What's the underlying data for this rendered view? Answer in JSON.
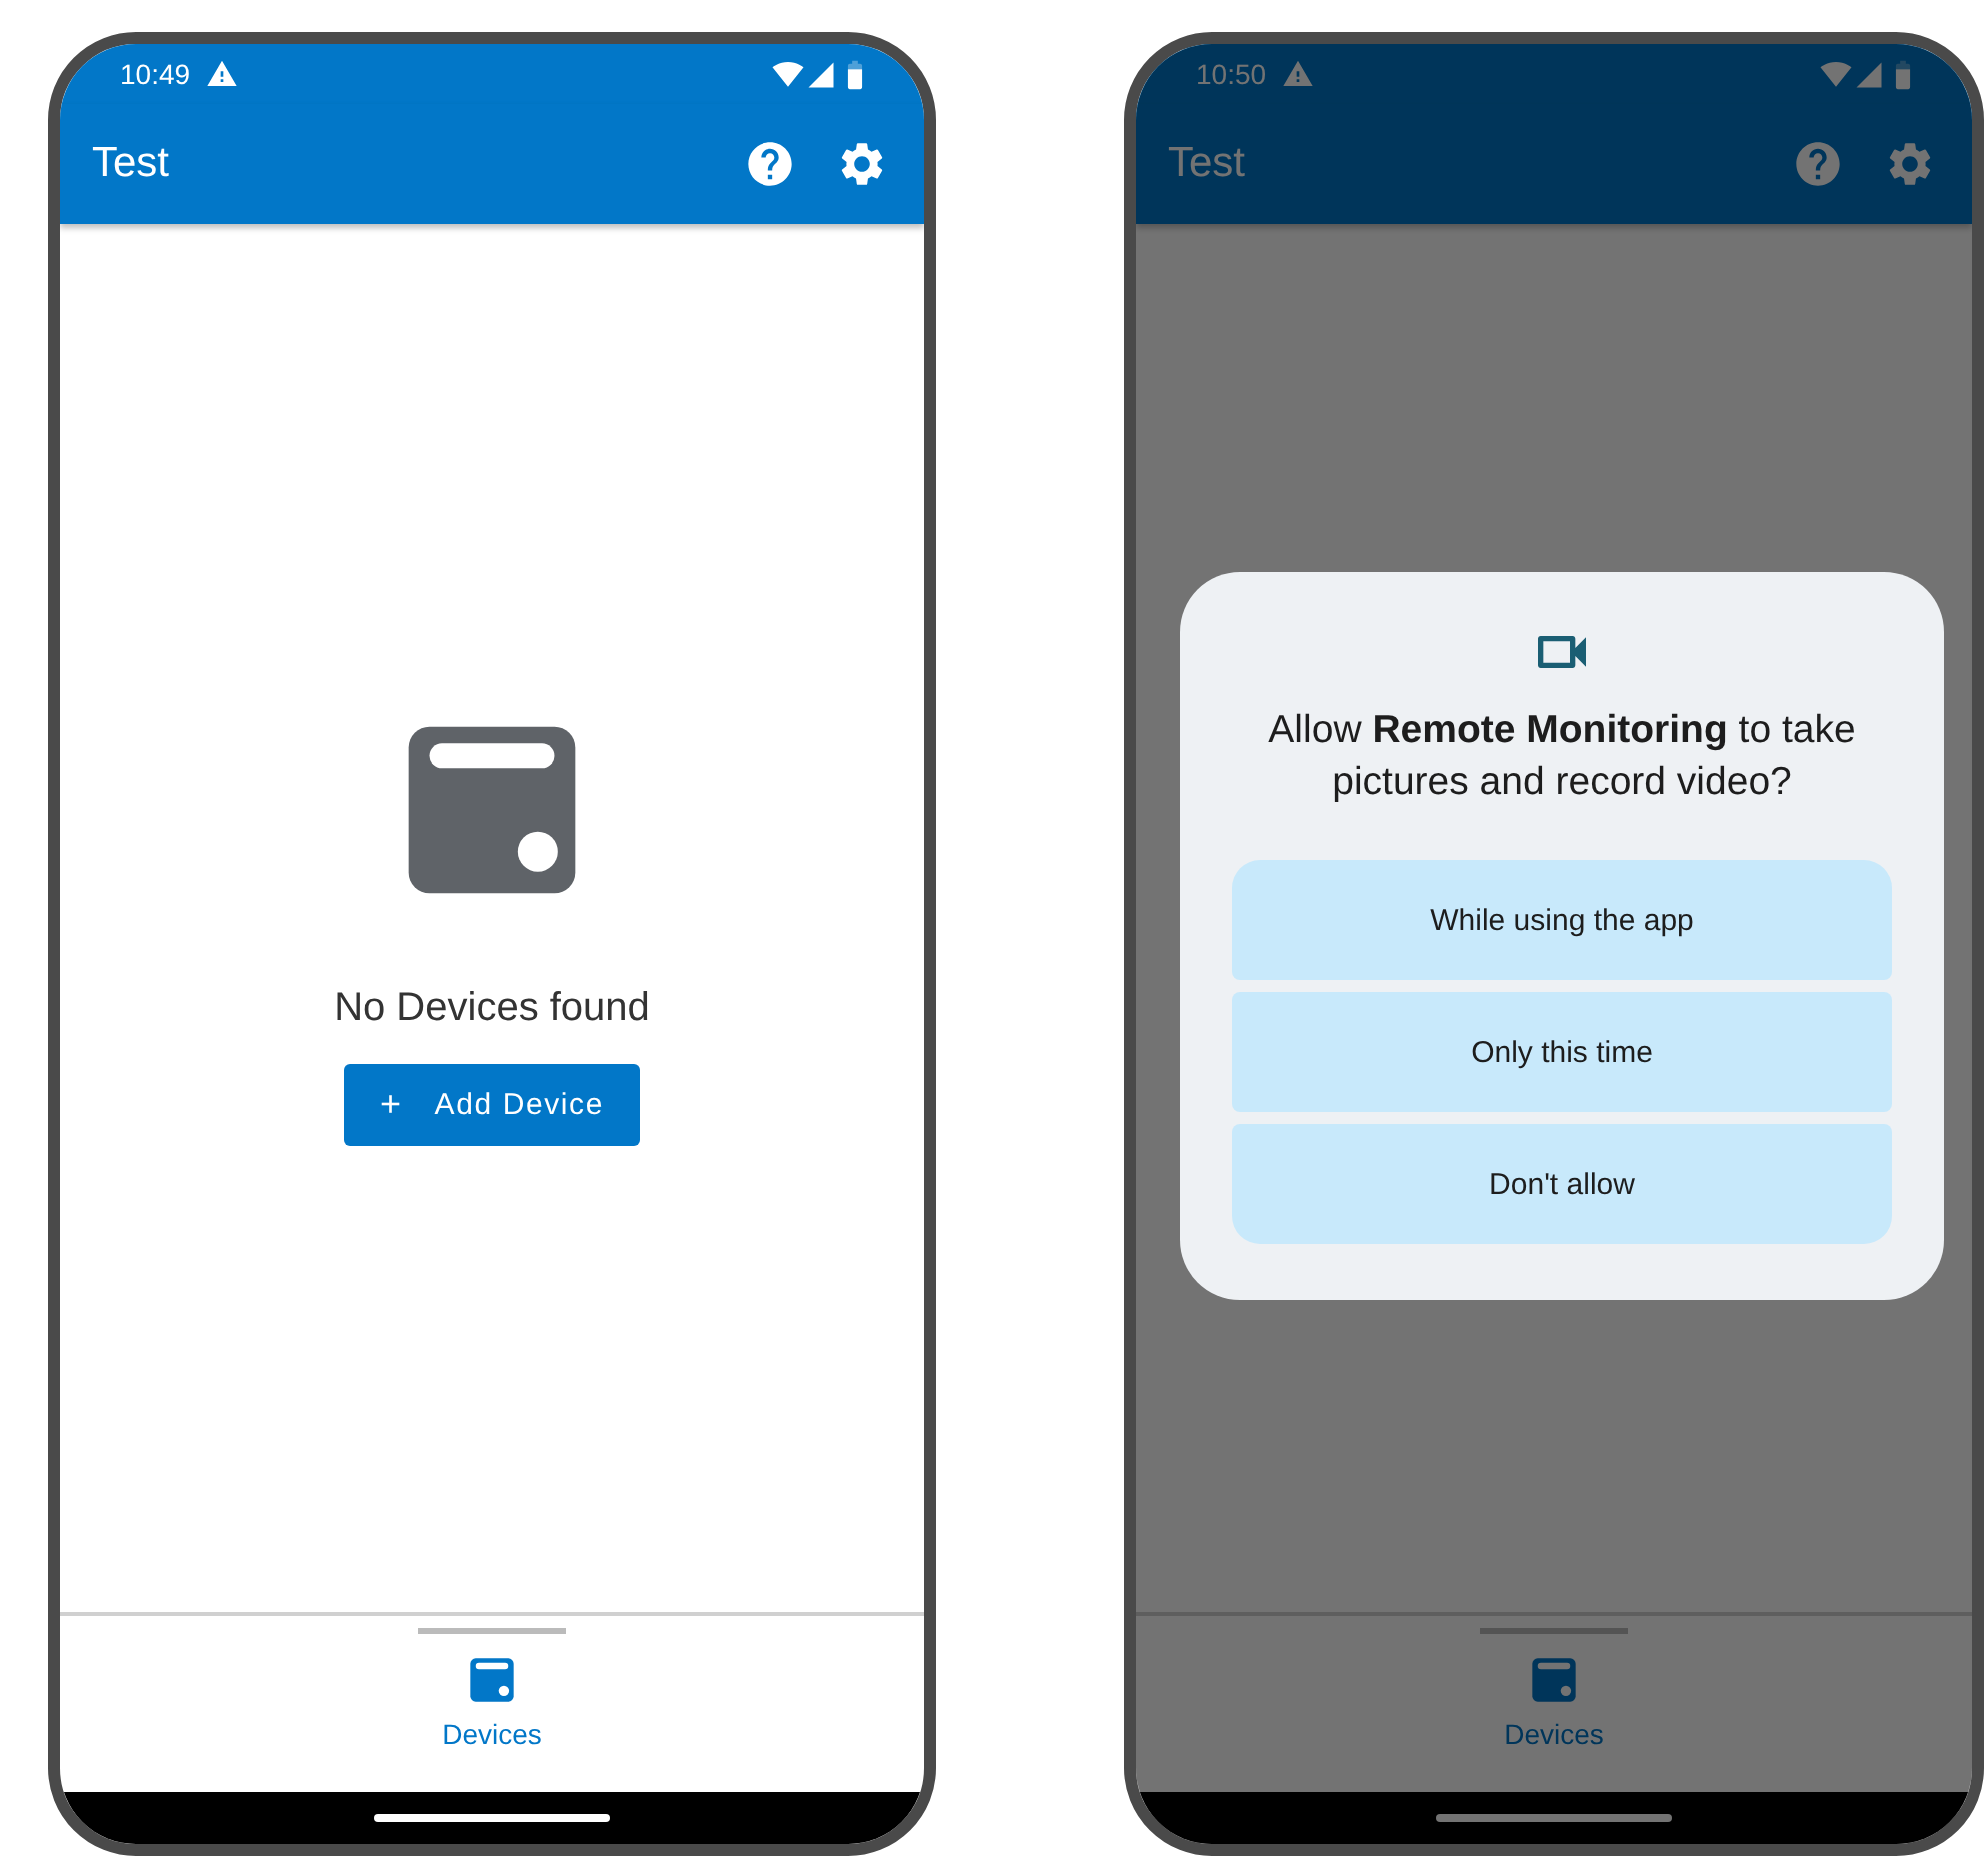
{
  "phones": [
    {
      "dimmed": false,
      "status_bar": {
        "time": "10:49"
      },
      "app_bar": {
        "title": "Test"
      },
      "empty_state": {
        "message": "No Devices found",
        "button_icon": "+",
        "button_label": "Add Device"
      },
      "bottom_nav": [
        {
          "label": "Devices",
          "selected": true
        }
      ]
    },
    {
      "dimmed": true,
      "status_bar": {
        "time": "10:50"
      },
      "app_bar": {
        "title": "Test"
      },
      "dialog": {
        "message": "Allow **Remote Monitoring** to take pictures and record video?",
        "options": [
          "While using the app",
          "Only this time",
          "Don't allow"
        ]
      },
      "bottom_nav": [
        {
          "label": "Devices",
          "selected": true
        }
      ]
    }
  ]
}
